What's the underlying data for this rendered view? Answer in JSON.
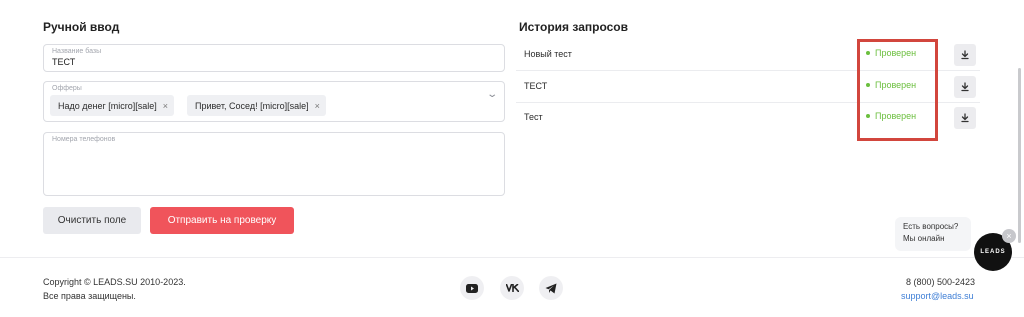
{
  "manual": {
    "title": "Ручной ввод",
    "db_label": "Название базы",
    "db_value": "ТЕСТ",
    "offers_label": "Офферы",
    "offers": [
      {
        "label": "Надо денег [micro][sale]",
        "remove": "×"
      },
      {
        "label": "Привет, Сосед! [micro][sale]",
        "remove": "×"
      }
    ],
    "chevron": "⌄",
    "phones_label": "Номера телефонов",
    "clear_label": "Очистить поле",
    "send_label": "Отправить на проверку"
  },
  "history": {
    "title": "История запросов",
    "rows": [
      {
        "name": "Новый тест",
        "status": "Проверен"
      },
      {
        "name": "ТЕСТ",
        "status": "Проверен"
      },
      {
        "name": "Тест",
        "status": "Проверен"
      }
    ]
  },
  "colors": {
    "accent": "#f0545b",
    "status_ok": "#6bbf3e",
    "highlight": "#d2463d",
    "link": "#3f7fd6"
  },
  "footer": {
    "copyright": "Copyright © LEADS.SU 2010-2023.",
    "rights": "Все права защищены.",
    "phone": "8 (800) 500-2423",
    "email": "support@leads.su",
    "social": [
      "youtube-icon",
      "vk-icon",
      "telegram-icon"
    ]
  },
  "chat": {
    "line1": "Есть вопросы?",
    "line2": "Мы онлайн",
    "logo": "LEADS",
    "close": "×"
  }
}
